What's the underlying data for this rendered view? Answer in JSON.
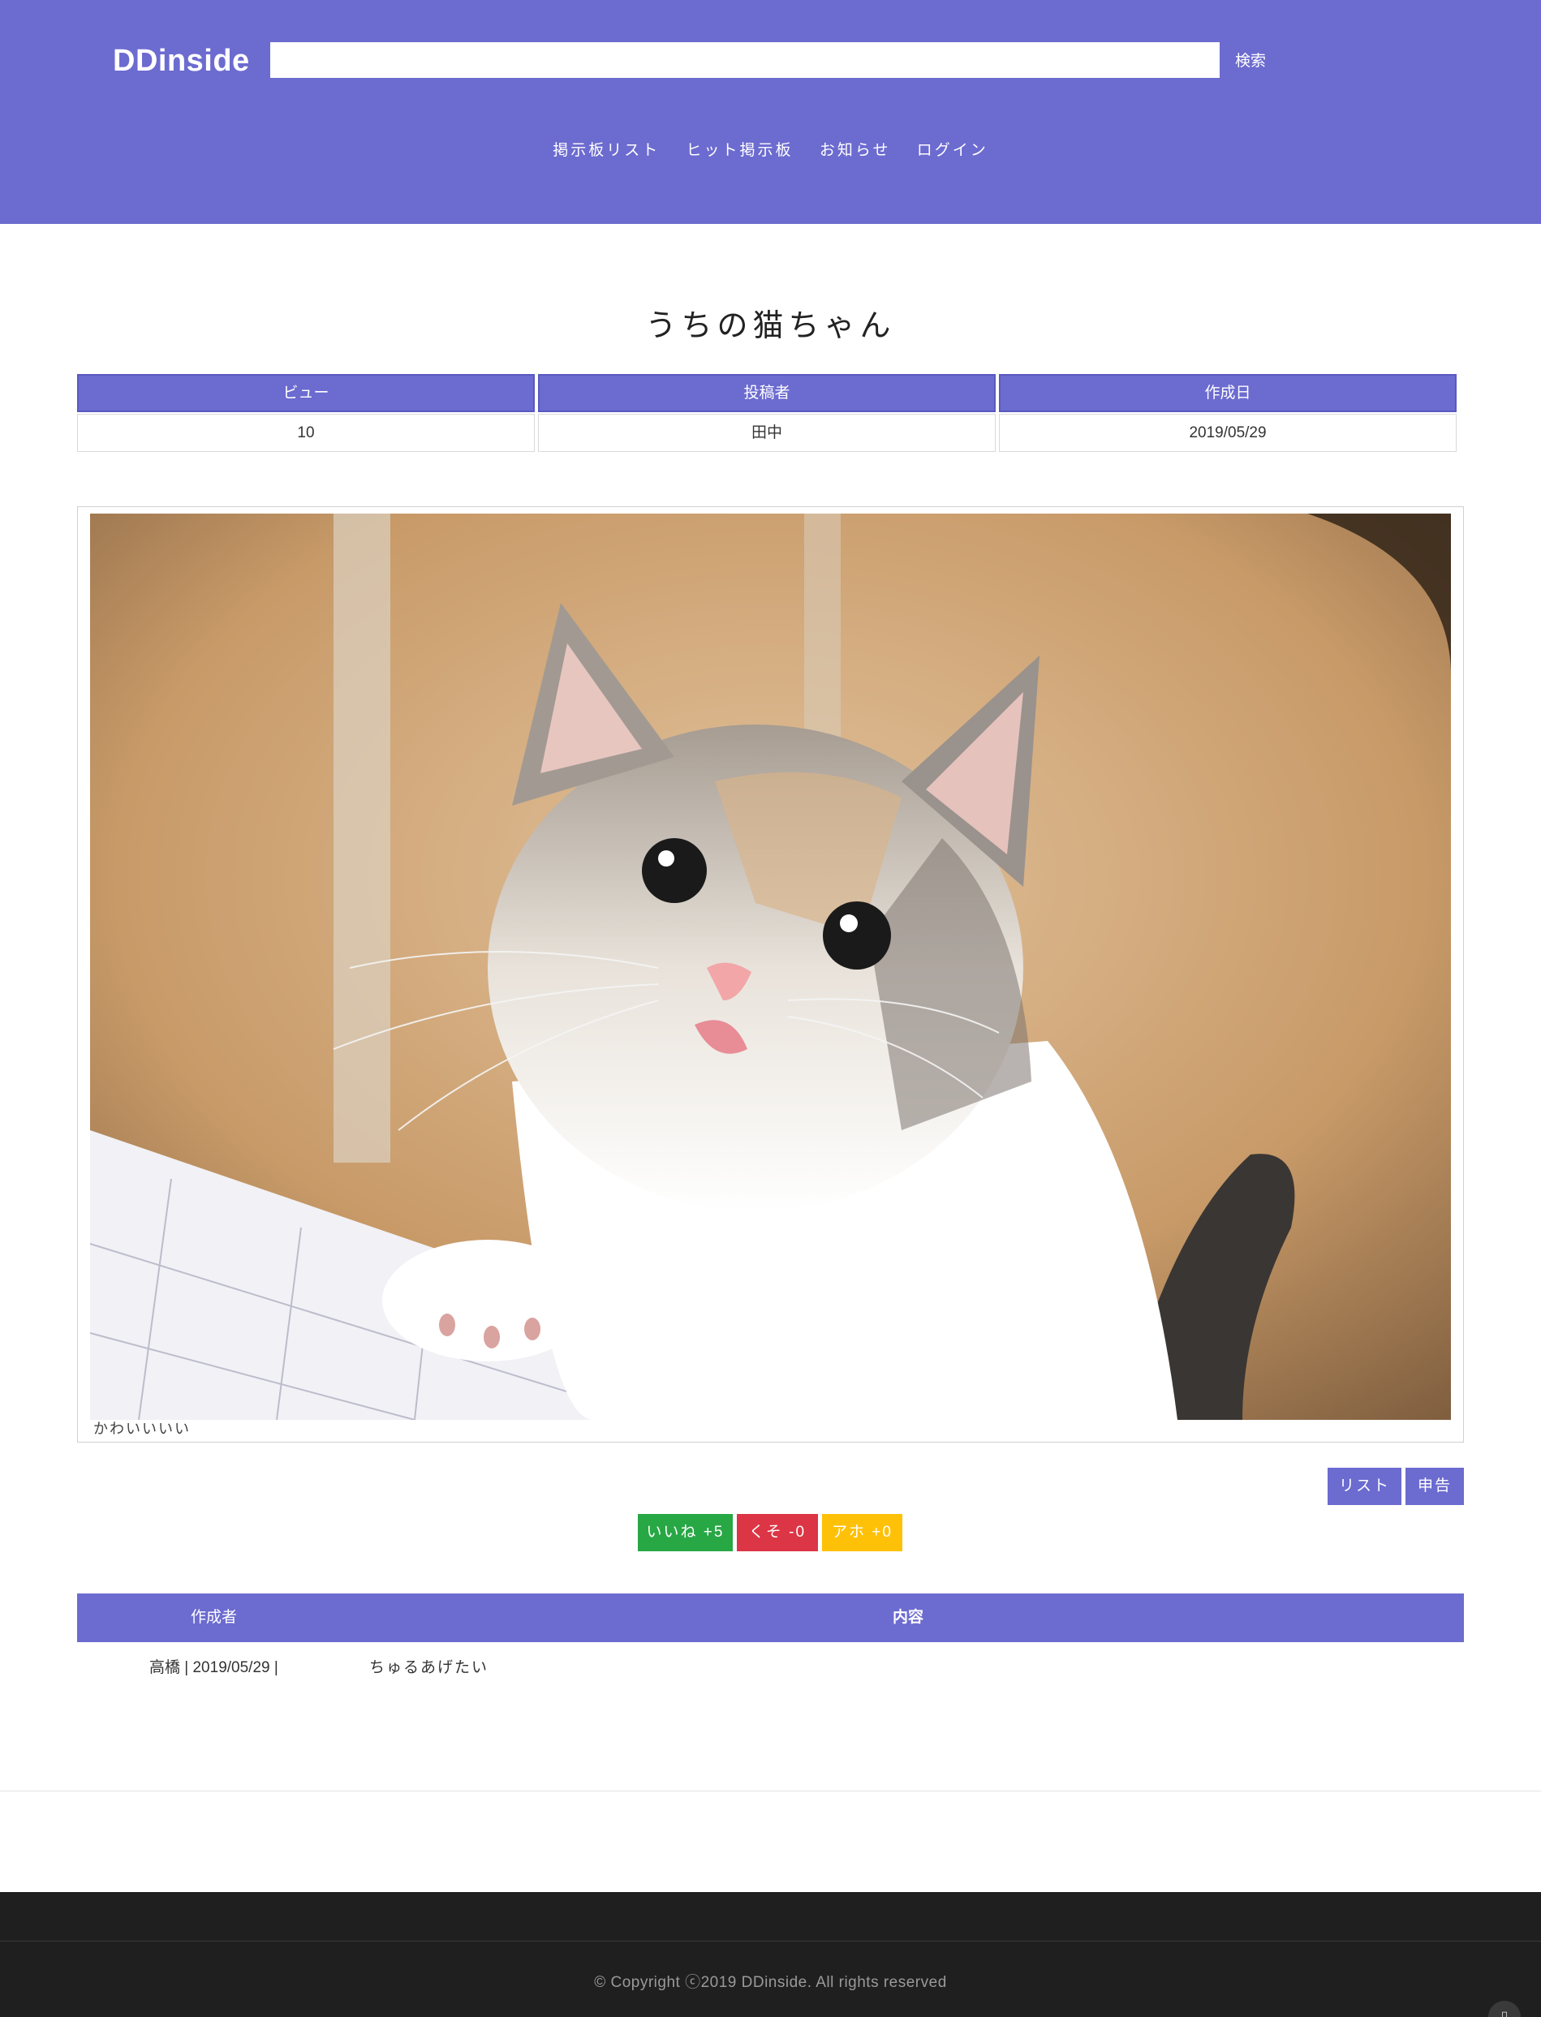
{
  "header": {
    "brand": "DDinside",
    "search_value": "",
    "search_button": "検索",
    "nav": [
      "掲示板リスト",
      "ヒット掲示板",
      "お知らせ",
      "ログイン"
    ]
  },
  "post": {
    "title": "うちの猫ちゃん",
    "info_headers": [
      "ビュー",
      "投稿者",
      "作成日"
    ],
    "info_values": [
      "10",
      "田中",
      "2019/05/29"
    ],
    "caption": "かわいいいい"
  },
  "actions": {
    "list_label": "リスト",
    "report_label": "申告",
    "like_label": "いいね +5",
    "bad_label": "くそ -0",
    "aho_label": "アホ +0"
  },
  "comments": {
    "author_header": "作成者",
    "content_header": "内容",
    "rows": [
      {
        "meta": "高橋 | 2019/05/29 |",
        "text": "ちゅるあげたい"
      }
    ]
  },
  "footer": {
    "copyright": "© Copyright ⓒ2019 DDinside. All rights reserved",
    "to_top_icon": "▯"
  },
  "colors": {
    "brand": "#6c6bd0",
    "like": "#28a745",
    "bad": "#dc3545",
    "aho": "#ffc107",
    "footer": "#1f1f1f"
  }
}
